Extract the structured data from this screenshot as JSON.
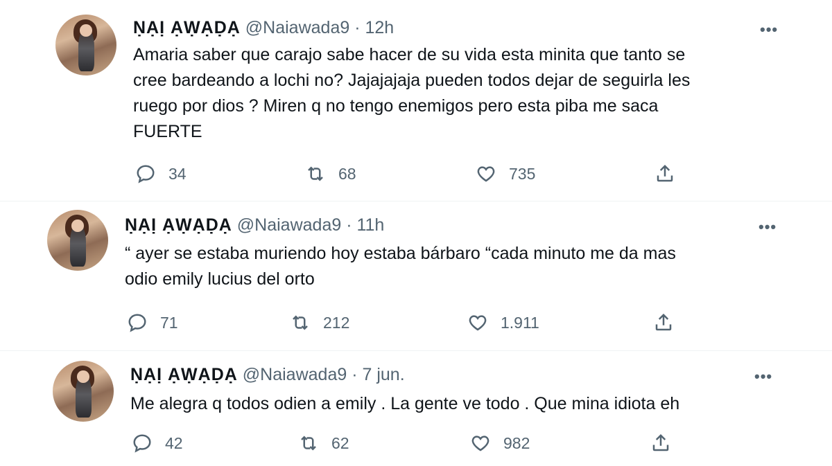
{
  "tweets": [
    {
      "name": "ṆẠỊ ẠẈẠḌẠ",
      "handle": "@Naiawada9",
      "separator": "·",
      "time": "12h",
      "text": "Amaria saber que carajo sabe hacer de su vida esta minita que tanto se\ncree bardeando a lochi no? Jajajajaja pueden todos dejar de seguirla les\nruego por dios ? Miren q no tengo enemigos pero esta piba me saca\nFUERTE",
      "replies": "34",
      "retweets": "68",
      "likes": "735"
    },
    {
      "name": "ṆẠỊ ẠẈẠḌẠ",
      "handle": "@Naiawada9",
      "separator": "·",
      "time": "11h",
      "text": "“ ayer se estaba muriendo hoy estaba bárbaro “cada minuto me da mas\nodio emily lucius del orto",
      "replies": "71",
      "retweets": "212",
      "likes": "1.911"
    },
    {
      "name": "ṆẠỊ ẠẈẠḌẠ",
      "handle": "@Naiawada9",
      "separator": "·",
      "time": "7 jun.",
      "text": "Me alegra q todos odien a emily . La gente ve todo . Que mina idiota eh",
      "replies": "42",
      "retweets": "62",
      "likes": "982"
    }
  ],
  "more_label": "•••",
  "icons": {
    "reply": "reply-icon",
    "retweet": "retweet-icon",
    "like": "heart-icon",
    "share": "share-icon",
    "more": "more-icon"
  },
  "colors": {
    "text": "#0f1419",
    "secondary": "#536471",
    "divider": "#eff3f4"
  }
}
